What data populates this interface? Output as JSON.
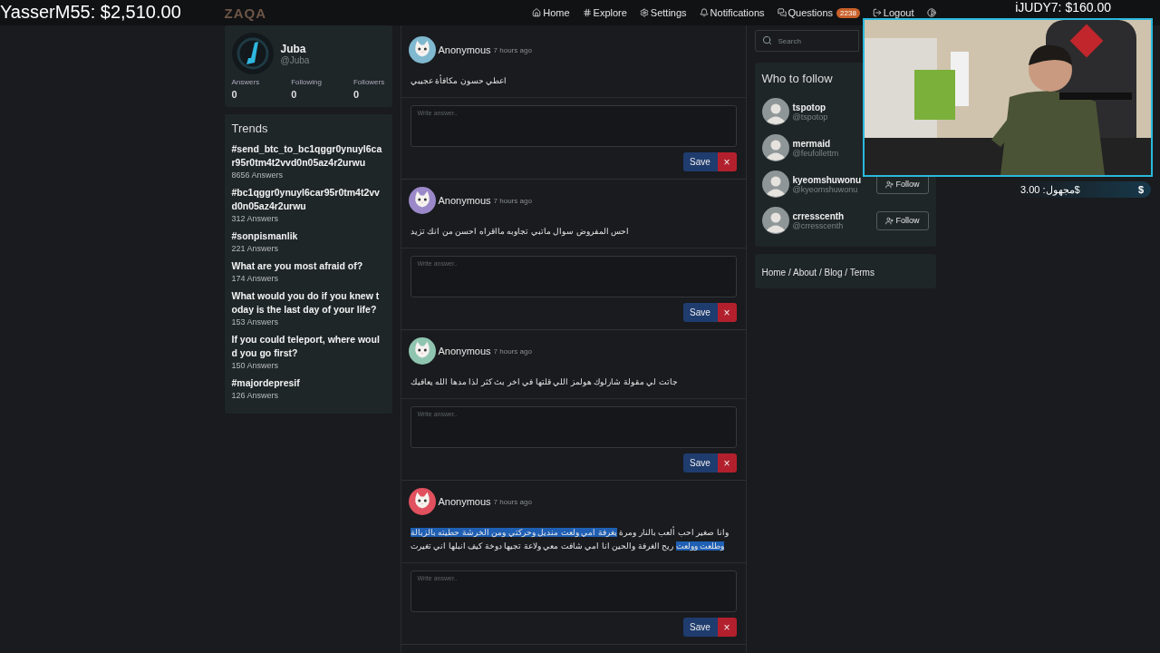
{
  "stream_overlay": {
    "top_left_donor": "YasserM55: $2,510.00",
    "top_right_donor": "iJUDY7: $160.00",
    "alert": {
      "icon": "$",
      "text": "مجهول: 3.00$"
    }
  },
  "navbar": {
    "logo": "ZAQA",
    "items": [
      {
        "label": "Home",
        "kind": "home"
      },
      {
        "label": "Explore",
        "kind": "hash"
      },
      {
        "label": "Settings",
        "kind": "settings"
      },
      {
        "label": "Notifications",
        "kind": "bell"
      },
      {
        "label": "Questions",
        "kind": "messages",
        "badge": "2238"
      },
      {
        "label": "Logout",
        "kind": "logout"
      },
      {
        "kind": "contrast"
      }
    ]
  },
  "profile": {
    "name": "Juba",
    "handle": "@Juba",
    "stats": [
      {
        "label": "Answers",
        "value": "0"
      },
      {
        "label": "Following",
        "value": "0"
      },
      {
        "label": "Followers",
        "value": "0"
      }
    ]
  },
  "trends": {
    "title": "Trends",
    "items": [
      {
        "title": "#send_btc_to_bc1qggr0ynuyl6car95r0tm4t2vvd0n05az4r2urwu",
        "count": "8656 Answers"
      },
      {
        "title": "#bc1qggr0ynuyl6car95r0tm4t2vvd0n05az4r2urwu",
        "count": "312 Answers"
      },
      {
        "title": "#sonpismanlik",
        "count": "221 Answers"
      },
      {
        "title": "What are you most afraid of?",
        "count": "174 Answers"
      },
      {
        "title": "What would you do if you knew today is the last day of your life?",
        "count": "153 Answers"
      },
      {
        "title": "If you could teleport, where would you go first?",
        "count": "150 Answers"
      },
      {
        "title": "#majordepresif",
        "count": "126 Answers"
      }
    ]
  },
  "questions": [
    {
      "author": "Anonymous",
      "time": "7 hours ago",
      "color": "#7fb8cf",
      "text": [
        {
          "text": "اعطي حسون مكافأة عجيبي",
          "selected": false
        }
      ],
      "answer_placeholder": "Write answer..",
      "save": "Save",
      "cancel": "×"
    },
    {
      "author": "Anonymous",
      "time": "7 hours ago",
      "color": "#9a88c9",
      "text": [
        {
          "text": "احس المفروض سوال ماتبي تجاوبه مااقراه احسن من انك تزيد",
          "selected": false
        }
      ],
      "answer_placeholder": "Write answer..",
      "save": "Save",
      "cancel": "×"
    },
    {
      "author": "Anonymous",
      "time": "7 hours ago",
      "color": "#8fc5b0",
      "text": [
        {
          "text": "جاتت لي مقولة شارلوك هولمز اللي قلتها في اخر بث كثر لذا مدها الله يعافيك",
          "selected": false
        }
      ],
      "answer_placeholder": "Write answer..",
      "save": "Save",
      "cancel": "×"
    },
    {
      "author": "Anonymous",
      "time": "7 hours ago",
      "color": "#e0505e",
      "text": [
        {
          "text": "وانا صغير احب ألعب بالنار ومرة ",
          "selected": false
        },
        {
          "text": "بغرفة امي ولعت منديل وحركتي ومن الخرشة حطيته بالزبالة وطلعت وولعت",
          "selected": true
        },
        {
          "text": " ريح الغرفة والحين انا امي شافت معي ولاعة تجيها دوخة كيف انبلها اني تغيرت",
          "selected": false
        }
      ],
      "answer_placeholder": "Write answer..",
      "save": "Save",
      "cancel": "×"
    }
  ],
  "search": {
    "placeholder": "Search"
  },
  "who_to_follow": {
    "title": "Who to follow",
    "users": [
      {
        "name": "tspotop",
        "handle": "@tspotop"
      },
      {
        "name": "mermaid",
        "handle": "@feufollettm"
      },
      {
        "name": "kyeomshuwonu",
        "handle": "@kyeomshuwonu",
        "follow": "Follow"
      },
      {
        "name": "crresscenth",
        "handle": "@crresscenth",
        "follow": "Follow"
      }
    ]
  },
  "footer": {
    "links": [
      "Home",
      "About",
      "Blog",
      "Terms"
    ],
    "separator": "/"
  }
}
